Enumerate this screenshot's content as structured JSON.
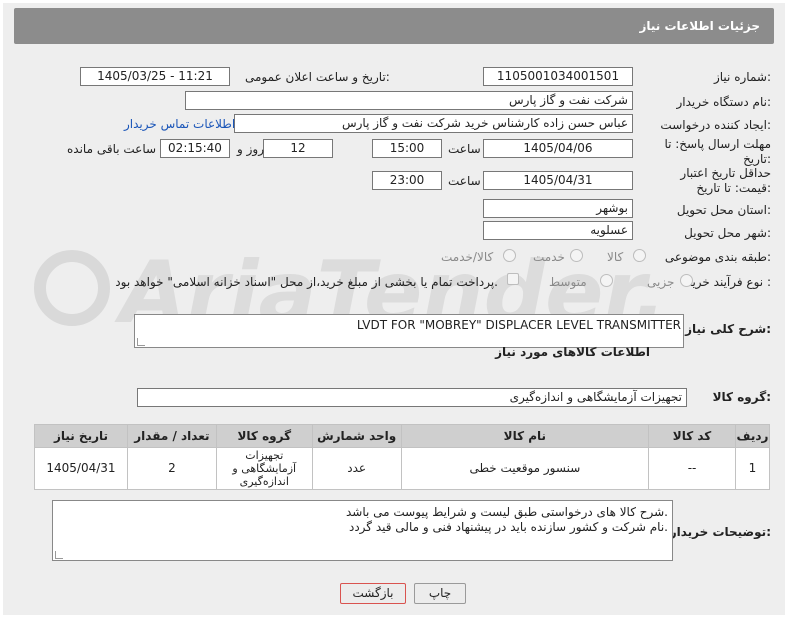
{
  "header": {
    "title": "جزئیات اطلاعات نیاز"
  },
  "fields": {
    "need_number_label": "شماره نیاز:",
    "need_number": "1105001034001501",
    "announce_label": "تاریخ و ساعت اعلان عمومی:",
    "announce_value": "1405/03/25 - 11:21",
    "buyer_org_label": "نام دستگاه خریدار:",
    "buyer_org": "شرکت نفت و گاز پارس",
    "creator_label": "ایجاد کننده درخواست:",
    "creator": "عباس حسن زاده کارشناس خرید شرکت نفت و گاز پارس",
    "contact_link": "اطلاعات تماس خریدار",
    "deadline_label": "مهلت ارسال پاسخ: تا تاریخ:",
    "deadline_date": "1405/04/06",
    "time_label": "ساعت",
    "deadline_time": "15:00",
    "days_value": "12",
    "days_label": "روز و",
    "remaining_time": "02:15:40",
    "remaining_label": "ساعت باقی مانده",
    "validity_label": "حداقل تاریخ اعتبار قیمت: تا تاریخ:",
    "validity_date": "1405/04/31",
    "validity_time": "23:00",
    "province_label": "استان محل تحویل:",
    "province": "بوشهر",
    "city_label": "شهر محل تحویل:",
    "city": "عسلویه",
    "category_label": "طبقه بندی موضوعی:",
    "category_options": [
      "کالا",
      "خدمت",
      "کالا/خدمت"
    ],
    "process_label": "نوع فرآیند خرید :",
    "process_options": [
      "جزیی",
      "متوسط"
    ],
    "payment_note": "پرداخت تمام یا بخشی از مبلغ خرید،از محل \"اسناد خزانه اسلامی\" خواهد بود."
  },
  "description": {
    "label": "شرح کلی نیاز:",
    "value": "LVDT FOR \"MOBREY\" DISPLACER LEVEL TRANSMITTER"
  },
  "goods_section": {
    "title": "اطلاعات کالاهای مورد نیاز",
    "group_label": "گروه کالا:",
    "group_value": "تجهیزات آزمایشگاهی و اندازه‌گیری"
  },
  "table": {
    "headers": [
      "ردیف",
      "کد کالا",
      "نام کالا",
      "واحد شمارش",
      "گروه کالا",
      "تعداد / مقدار",
      "تاریخ نیاز"
    ],
    "rows": [
      [
        "1",
        "--",
        "سنسور موقعیت خطی",
        "عدد",
        "تجهیزات آزمایشگاهی و اندازه‌گیری",
        "2",
        "1405/04/31"
      ]
    ]
  },
  "buyer_notes": {
    "label": "توضیحات خریدار:",
    "line1": "شرح کالا های درخواستی طبق لیست و شرایط پیوست می باشد.",
    "line2": "نام شرکت و کشور سازنده باید در پیشنهاد فنی و مالی قید گردد."
  },
  "buttons": {
    "print": "چاپ",
    "back": "بازگشت"
  },
  "watermark": {
    "text": "AriaTender.net"
  },
  "colors": {
    "header_bg": "#8c8c8c",
    "link": "#1a55b8",
    "back_border": "#d9534f",
    "watermark": "#d9d9d9"
  }
}
